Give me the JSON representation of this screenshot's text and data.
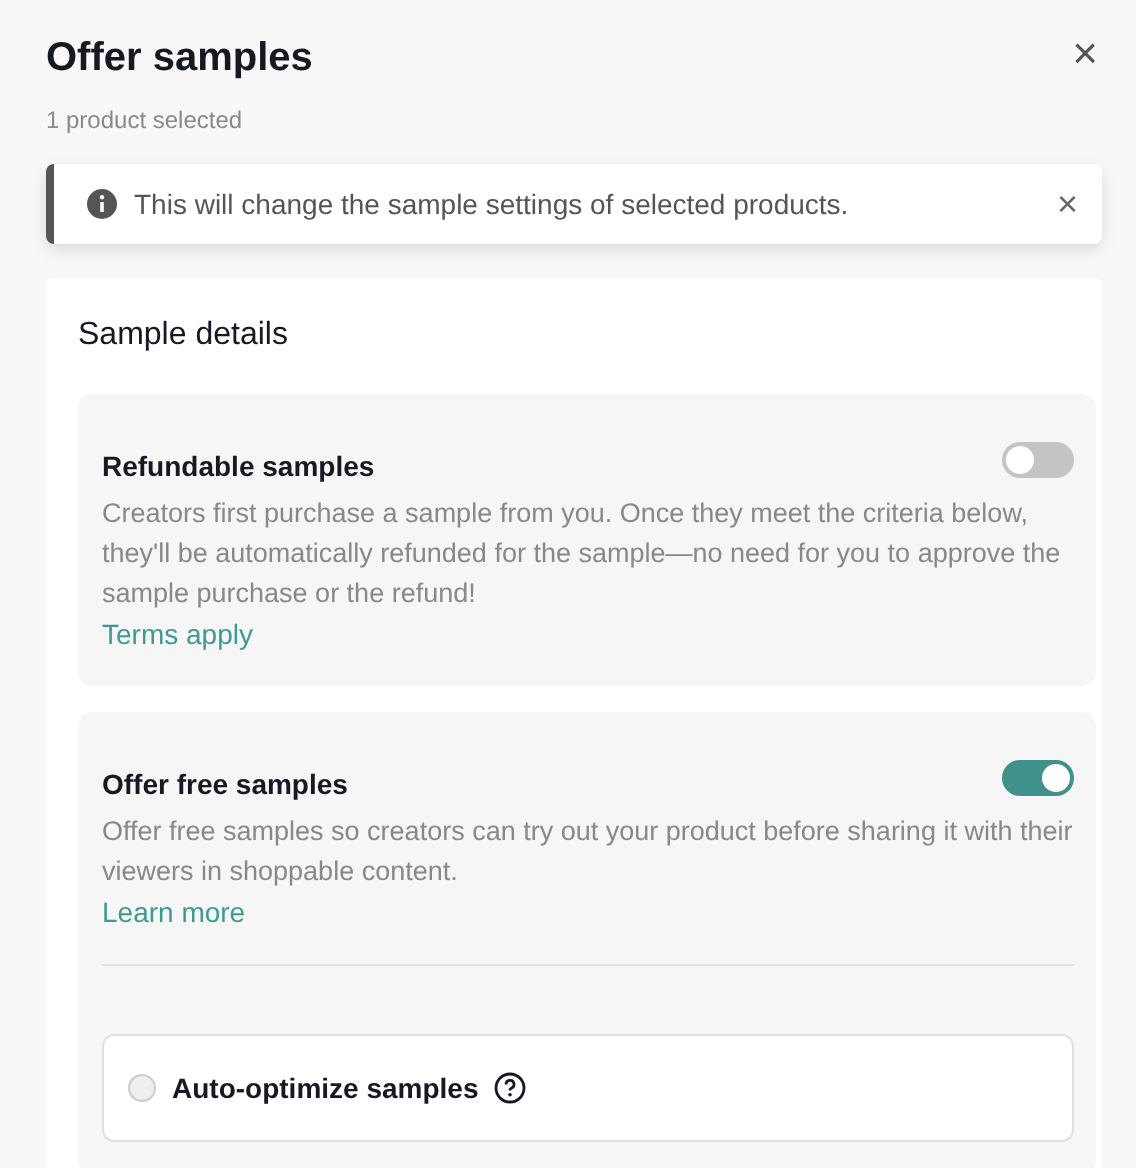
{
  "dialog": {
    "title": "Offer samples",
    "subtitle": "1 product selected",
    "close": "×"
  },
  "notice": {
    "text": "This will change the sample settings of selected products.",
    "close": "×"
  },
  "section": {
    "title": "Sample details",
    "options": [
      {
        "kind": "toggle",
        "title": "Refundable samples",
        "on": false,
        "description": "Creators first purchase a sample from you. Once they meet the criteria below, they'll be automatically refunded for the sample—no need for you to approve the sample purchase or the refund!",
        "link": "Terms apply"
      },
      {
        "kind": "toggle",
        "title": "Offer free samples",
        "on": true,
        "description": "Offer free samples so creators can try out your product before sharing it with their viewers in shoppable content.",
        "link": "Learn more",
        "choices": [
          {
            "label": "Auto-optimize samples",
            "selected": false
          }
        ]
      }
    ]
  }
}
